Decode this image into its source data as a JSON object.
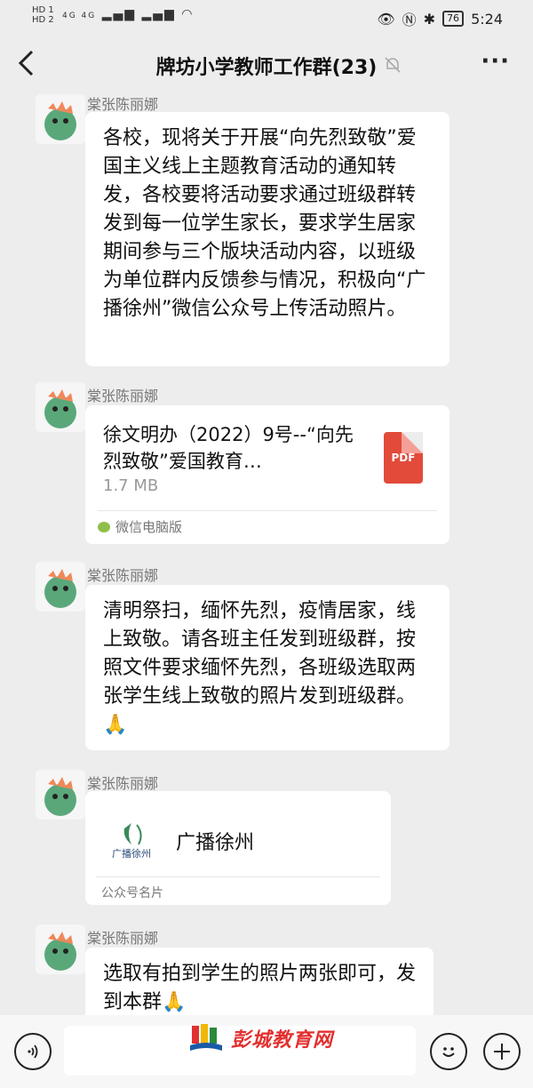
{
  "status_bar": {
    "hd1": "HD 1",
    "hd2": "HD 2",
    "net": "4G 4G",
    "battery": "76",
    "time": "5:24"
  },
  "header": {
    "title": "牌坊小学教师工作群(23)",
    "more": "···"
  },
  "messages": [
    {
      "sender": "棠张陈丽娜",
      "text": "各校，现将关于开展“向先烈致敬”爱国主义线上主题教育活动的通知转发，各校要将活动要求通过班级群转发到每一位学生家长，要求学生居家期间参与三个版块活动内容，以班级为单位群内反馈参与情况，积极向“广播徐州”微信公众号上传活动照片。"
    },
    {
      "sender": "棠张陈丽娜",
      "file_name": "徐文明办（2022）9号--“向先烈致敬”爱国教育…",
      "file_size": "1.7 MB",
      "file_type": "PDF",
      "source": "微信电脑版"
    },
    {
      "sender": "棠张陈丽娜",
      "text": "清明祭扫，缅怀先烈，疫情居家，线上致敬。请各班主任发到班级群，按照文件要求缅怀先烈，各班级选取两张学生线上致敬的照片发到班级群。🙏"
    },
    {
      "sender": "棠张陈丽娜",
      "card_name": "广播徐州",
      "card_logo_text": "广播徐州",
      "card_footer": "公众号名片"
    },
    {
      "sender": "棠张陈丽娜",
      "text": "选取有拍到学生的照片两张即可，发到本群🙏"
    }
  ],
  "watermark": "彭城教育网",
  "colors": {
    "background": "#ededed",
    "bubble": "#ffffff",
    "pdf": "#e24a3a",
    "watermark": "#e23030"
  },
  "icons": [
    "back-icon",
    "mute-bell-icon",
    "more-icon",
    "voice-icon",
    "emoji-icon",
    "plus-icon",
    "pdf-icon"
  ]
}
